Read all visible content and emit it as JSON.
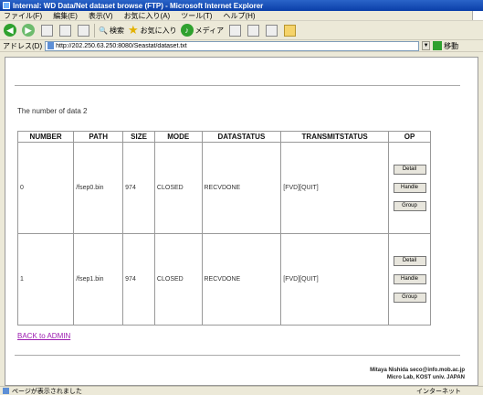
{
  "window": {
    "title": "Internal: WD Data/Net dataset browse (FTP) - Microsoft Internet Explorer"
  },
  "menu": [
    "ファイル(F)",
    "編集(E)",
    "表示(V)",
    "お気に入り(A)",
    "ツール(T)",
    "ヘルプ(H)"
  ],
  "toolbar": {
    "search_label": "検索",
    "favorites_label": "お気に入り",
    "media_label": "メディア"
  },
  "address": {
    "label": "アドレス(D)",
    "url": "http://202.250.63.250:8080/Seastat/dataset.txt",
    "go_label": "移動"
  },
  "page": {
    "count_text": "The number of data 2",
    "headers": [
      "NUMBER",
      "PATH",
      "SIZE",
      "MODE",
      "DATASTATUS",
      "TRANSMITSTATUS",
      "OP"
    ],
    "rows": [
      {
        "number": "0",
        "path": "/fsep0.bin",
        "size": "974",
        "mode": "CLOSED",
        "datastatus": "RECVDONE",
        "transmitstatus": "[FVD][QUIT]"
      },
      {
        "number": "1",
        "path": "/fsep1.bin",
        "size": "974",
        "mode": "CLOSED",
        "datastatus": "RECVDONE",
        "transmitstatus": "[FVD][QUIT]"
      }
    ],
    "ops": {
      "detail": "Detail",
      "handle": "Handle",
      "group": "Group"
    },
    "back_link": "BACK to ADMIN",
    "footer_line1": "Mitaya Nishida  seco@info.mob.ac.jp",
    "footer_line2": "Micro Lab, KOST univ. JAPAN"
  },
  "status": {
    "text": "ページが表示されました",
    "zone": "インターネット"
  }
}
